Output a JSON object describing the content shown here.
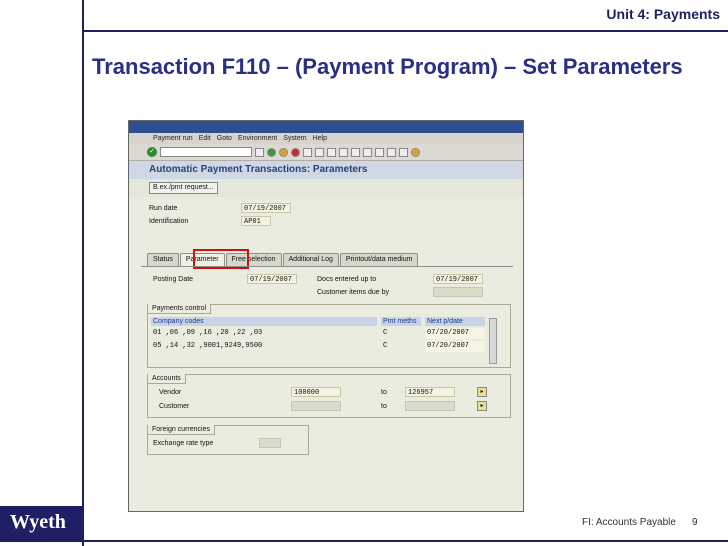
{
  "slide": {
    "unit_title": "Unit 4: Payments",
    "title": "Transaction F110 – (Payment Program) – Set Parameters",
    "footer_text": "FI: Accounts Payable",
    "page_number": "9",
    "logo_text": "Wyeth"
  },
  "sap": {
    "menu": [
      "Payment run",
      "Edit",
      "Goto",
      "Environment",
      "System",
      "Help"
    ],
    "screen_title": "Automatic Payment Transactions: Parameters",
    "app_button": "B.ex./pmt request...",
    "run_date_label": "Run date",
    "run_date_value": "07/19/2007",
    "identification_label": "Identification",
    "identification_value": "AP01",
    "tabs": [
      "Status",
      "Parameter",
      "Free selection",
      "Additional Log",
      "Printout/data medium"
    ],
    "posting_date_label": "Posting Date",
    "posting_date_value": "07/19/2007",
    "docs_entered_label": "Docs entered up to",
    "docs_entered_value": "07/19/2007",
    "customer_items_label": "Customer items due by",
    "payments_control_title": "Payments control",
    "table_headers": [
      "Company codes",
      "Pmt meths",
      "Next p/date"
    ],
    "rows": [
      {
        "codes": "01  ,06  ,09  ,16  ,20  ,22  ,03",
        "meths": "C",
        "next": "07/20/2007"
      },
      {
        "codes": "05  ,14  ,32  ,9001,9249,9500",
        "meths": "C",
        "next": "07/20/2007"
      }
    ],
    "accounts_title": "Accounts",
    "vendor_label": "Vendor",
    "vendor_from": "100000",
    "to_label": "to",
    "vendor_to": "126957",
    "customer_label": "Customer",
    "foreign_title": "Foreign currencies",
    "exchange_rate_label": "Exchange rate type"
  }
}
